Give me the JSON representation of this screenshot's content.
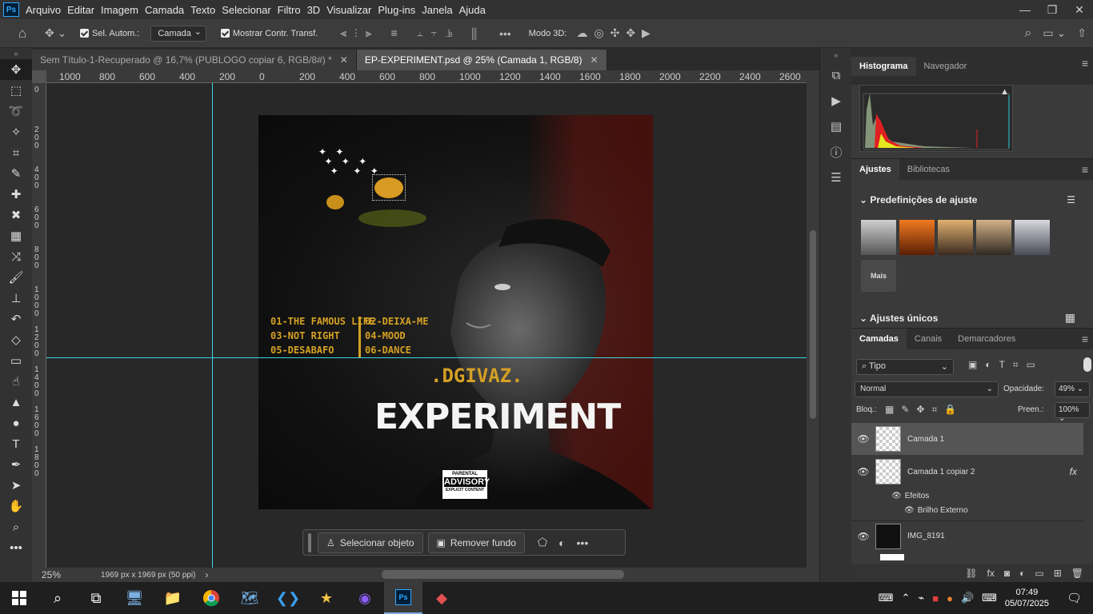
{
  "menubar": {
    "app_icon": "Ps",
    "items": [
      "Arquivo",
      "Editar",
      "Imagem",
      "Camada",
      "Texto",
      "Selecionar",
      "Filtro",
      "3D",
      "Visualizar",
      "Plug-ins",
      "Janela",
      "Ajuda"
    ],
    "window_controls": [
      "—",
      "❐",
      "✕"
    ]
  },
  "options": {
    "auto_select_label": "Sel. Autom.:",
    "auto_select_target": "Camada",
    "show_transform_label": "Mostrar Contr. Transf.",
    "mode3d_label": "Modo 3D:"
  },
  "tabs": [
    {
      "label": "Sem Título-1-Recuperado @ 16,7% (PUBLOGO copiar 6, RGB/8#) *",
      "active": false
    },
    {
      "label": "EP-EXPERIMENT.psd @ 25% (Camada 1, RGB/8)",
      "active": true
    }
  ],
  "ruler": {
    "h_labels": [
      "1000",
      "800",
      "600",
      "400",
      "200",
      "0",
      "200",
      "400",
      "600",
      "800",
      "1000",
      "1200",
      "1400",
      "1600",
      "1800",
      "2000",
      "2200",
      "2400",
      "2600"
    ],
    "v_labels": [
      "0",
      "2 0 0",
      "4 0 0",
      "6 0 0",
      "8 0 0",
      "1 0 0 0",
      "1 2 0 0",
      "1 4 0 0",
      "1 6 0 0",
      "1 8 0 0"
    ]
  },
  "artwork": {
    "tracks_left": [
      "01-THE FAMOUS LIFE",
      "03-NOT RIGHT",
      "05-DESABAFO"
    ],
    "tracks_right": [
      "02-DEIXA-ME",
      "04-MOOD",
      "06-DANCE"
    ],
    "artist": ".DGIVAZ.",
    "title": "EXPERIMENT",
    "advisory_top": "PARENTAL",
    "advisory_main": "ADVISORY",
    "advisory_bottom": "EXPLICIT CONTENT"
  },
  "status": {
    "zoom": "25%",
    "doc_size": "1969 px x 1969 px (50 ppi)"
  },
  "context_bar": {
    "select_subject": "Selecionar objeto",
    "remove_bg": "Remover fundo"
  },
  "panels": {
    "histogram_tabs": [
      "Histograma",
      "Navegador"
    ],
    "adjust_tabs": [
      "Ajustes",
      "Bibliotecas"
    ],
    "adjust_presets_title": "Predefinições de ajuste",
    "adjust_more": "Mais",
    "single_adjust_title": "Ajustes únicos",
    "layers_tabs": [
      "Camadas",
      "Canais",
      "Demarcadores"
    ],
    "filter_kind": "Tipo",
    "blend_mode": "Normal",
    "opacity_label": "Opacidade:",
    "opacity_value": "49%",
    "lock_label": "Bloq.:",
    "fill_label": "Preen.:",
    "fill_value": "100%",
    "layers": [
      {
        "name": "Camada 1"
      },
      {
        "name": "Camada 1 copiar 2",
        "fx": "fx"
      },
      {
        "name": "Efeitos"
      },
      {
        "name": "Brilho Externo"
      },
      {
        "name": "IMG_8191"
      }
    ]
  },
  "taskbar": {
    "time": "07:49",
    "date": "05/07/2025"
  },
  "colors": {
    "guide": "#39d6e6",
    "accent_gold": "#d4a024"
  }
}
